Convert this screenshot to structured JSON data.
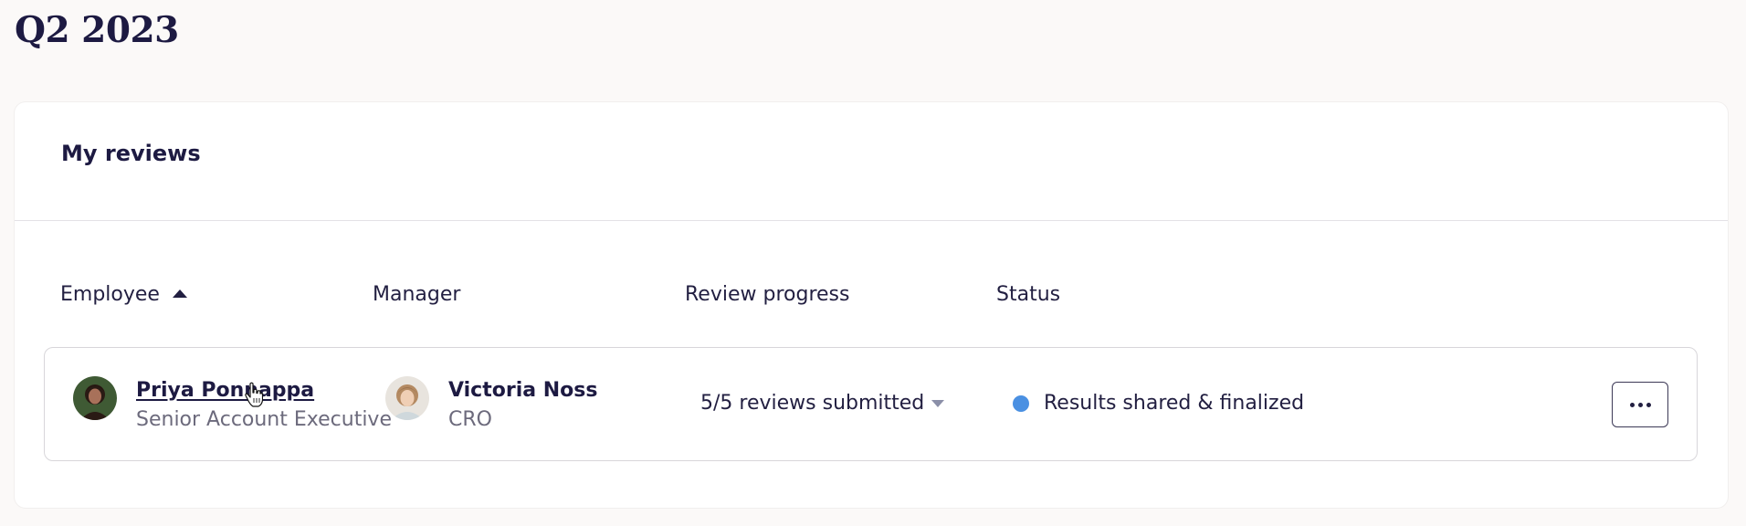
{
  "page": {
    "title": "Q2 2023"
  },
  "card": {
    "title": "My reviews"
  },
  "table": {
    "headers": {
      "employee": "Employee",
      "manager": "Manager",
      "progress": "Review progress",
      "status": "Status"
    },
    "rows": [
      {
        "employee_name": "Priya Ponnappa",
        "employee_title": "Senior Account Executive",
        "manager_name": "Victoria Noss",
        "manager_title": "CRO",
        "progress": "5/5 reviews submitted",
        "status": "Results shared & finalized",
        "status_color": "#4a90e2"
      }
    ]
  },
  "icons": {
    "sort": "sort-ascending-icon",
    "progress_caret": "chevron-down-icon",
    "more": "more-horizontal-icon",
    "cursor": "hand-pointer-icon"
  }
}
